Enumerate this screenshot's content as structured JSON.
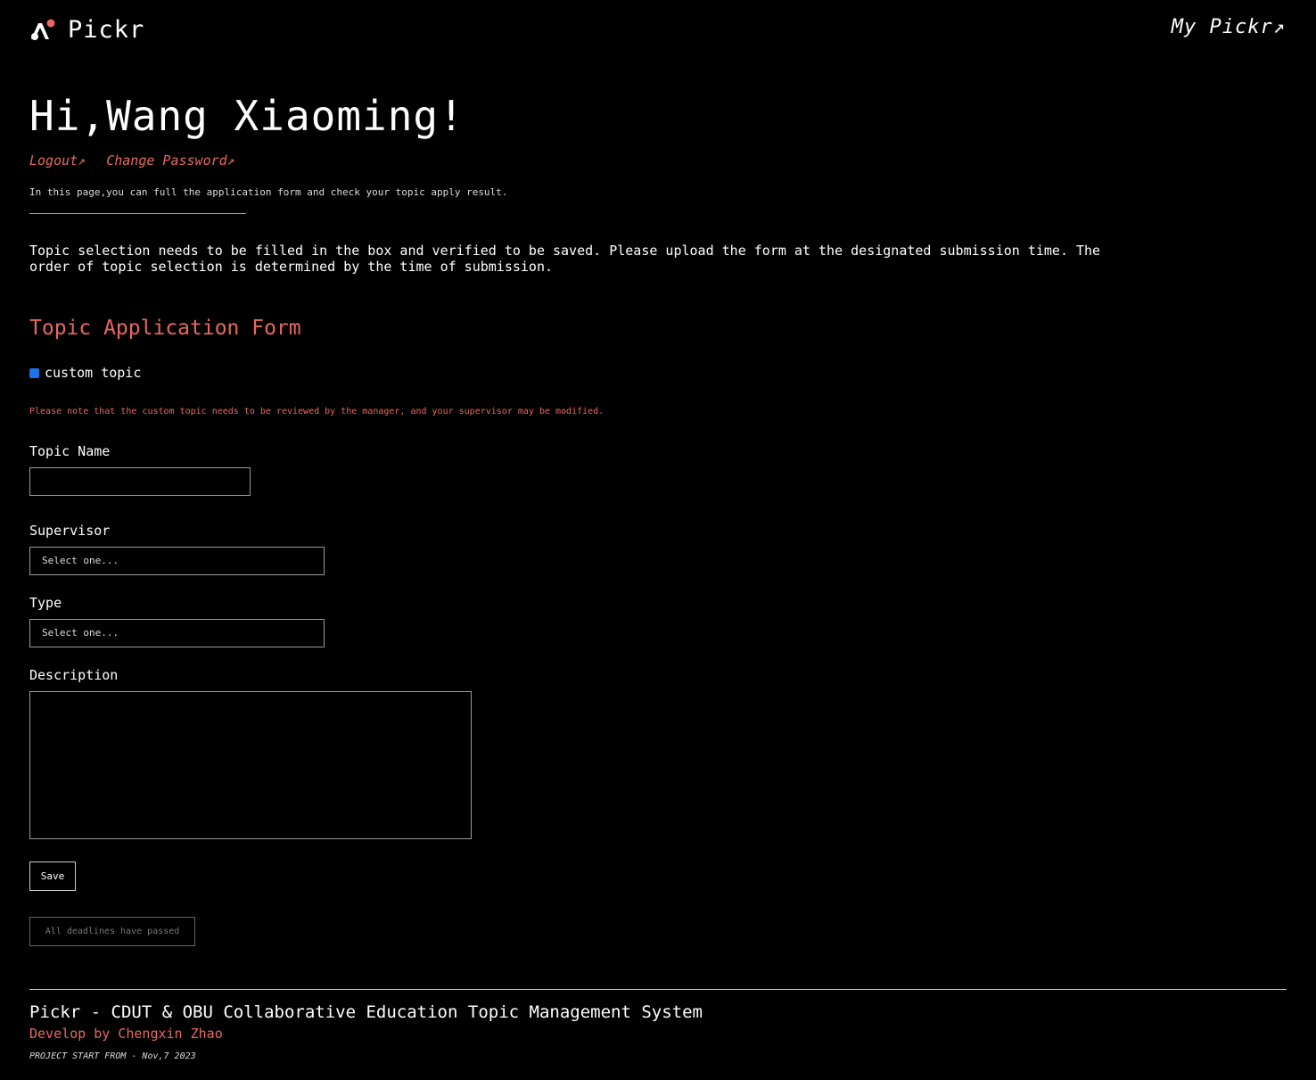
{
  "header": {
    "logo_text": "Pickr",
    "my_pickr_link": "My Pickr↗"
  },
  "greeting": "Hi,Wang Xiaoming!",
  "links": {
    "logout": "Logout↗",
    "change_password": "Change Password↗"
  },
  "intro": "In this page,you can full the application form and check your topic apply result.",
  "notice": "Topic selection needs to be filled in the box and verified to be saved. Please upload the form at the designated submission time. The order of topic selection is determined by the time of submission.",
  "form": {
    "title": "Topic Application Form",
    "custom_topic_label": "custom topic",
    "custom_topic_checked": true,
    "note": "Please note that the custom topic needs to be reviewed by the manager, and your supervisor may be modified.",
    "topic_name_label": "Topic Name",
    "topic_name_value": "",
    "supervisor_label": "Supervisor",
    "supervisor_value": "Select one...",
    "type_label": "Type",
    "type_value": "Select one...",
    "description_label": "Description",
    "description_value": "",
    "save_label": "Save",
    "deadline_label": "All deadlines have passed"
  },
  "footer": {
    "title": "Pickr - CDUT & OBU Collaborative Education Topic Management System",
    "developer": "Develop by Chengxin Zhao",
    "start": "PROJECT START FROM - Nov,7 2023"
  },
  "colors": {
    "background": "#000000",
    "accent": "#e8685f",
    "checkbox": "#1a73e8"
  }
}
